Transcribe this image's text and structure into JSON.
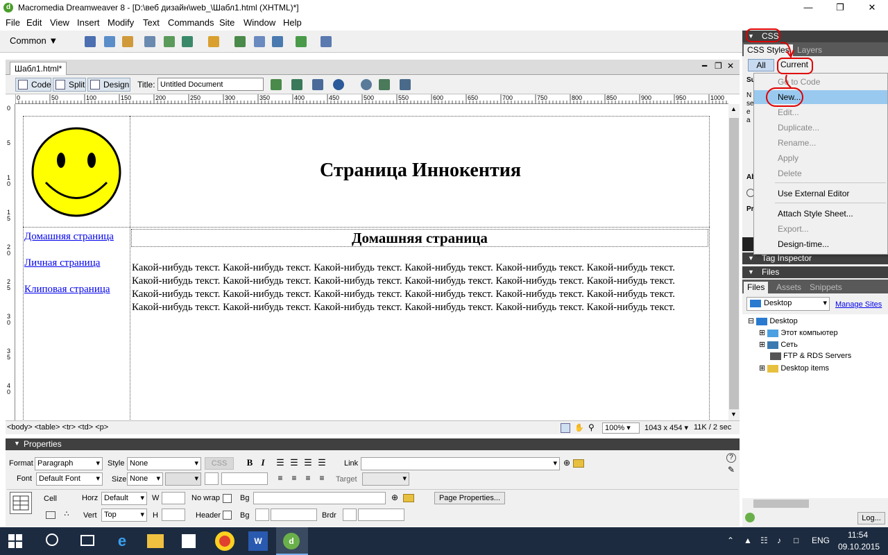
{
  "window": {
    "title": "Macromedia Dreamweaver 8 - [D:\\веб дизайн\\web_\\Шабл1.html (XHTML)*]"
  },
  "menu": [
    "File",
    "Edit",
    "View",
    "Insert",
    "Modify",
    "Text",
    "Commands",
    "Site",
    "Window",
    "Help"
  ],
  "insert_bar": {
    "category": "Common"
  },
  "doc_tab": {
    "label": "Шабл1.html*"
  },
  "doc_toolbar": {
    "code_label": "Code",
    "split_label": "Split",
    "design_label": "Design",
    "title_label": "Title:",
    "title_value": "Untitled Document"
  },
  "ruler": {
    "h_ticks": [
      "0",
      "50",
      "100",
      "150",
      "200",
      "250",
      "300",
      "350",
      "400",
      "450",
      "500",
      "550",
      "600",
      "650",
      "700",
      "750",
      "800",
      "850",
      "900",
      "950",
      "1000"
    ],
    "v_ticks": [
      "0",
      "5",
      "1 0",
      "1 5",
      "2 0",
      "2 5",
      "3 0",
      "3 5",
      "4 0"
    ]
  },
  "page": {
    "heading": "Страница Иннокентия",
    "subheading": "Домашняя страница",
    "nav": [
      "Домашняя страница",
      "Личная страница",
      "Клиповая страница"
    ],
    "body_text": "Какой-нибудь текст. Какой-нибудь текст. Какой-нибудь текст. Какой-нибудь текст. Какой-нибудь текст. Какой-нибудь текст. Какой-нибудь текст. Какой-нибудь текст. Какой-нибудь текст. Какой-нибудь текст. Какой-нибудь текст. Какой-нибудь текст. Какой-нибудь текст. Какой-нибудь текст. Какой-нибудь текст. Какой-нибудь текст. Какой-нибудь текст. Какой-нибудь текст. Какой-нибудь текст. Какой-нибудь текст. Какой-нибудь текст. Какой-нибудь текст. Какой-нибудь текст. Какой-нибудь текст."
  },
  "status": {
    "tags": "<body> <table> <tr> <td> <p>",
    "zoom": "100%",
    "size": "1043 x 454",
    "download": "11K / 2 sec"
  },
  "properties": {
    "header": "Properties",
    "format_label": "Format",
    "format_value": "Paragraph",
    "style_label": "Style",
    "style_value": "None",
    "css_label": "CSS",
    "bold": "B",
    "italic": "I",
    "link_label": "Link",
    "font_label": "Font",
    "font_value": "Default Font",
    "size_label": "Size",
    "size_value": "None",
    "target_label": "Target",
    "cell_label": "Cell",
    "horz_label": "Horz",
    "horz_value": "Default",
    "w_label": "W",
    "nowrap_label": "No wrap",
    "bg_label": "Bg",
    "page_props": "Page Properties...",
    "vert_label": "Vert",
    "vert_value": "Top",
    "h_label": "H",
    "header_label": "Header",
    "brdr_label": "Brdr"
  },
  "css_panel": {
    "header": "CSS",
    "tabs": [
      "CSS Styles",
      "Layers"
    ],
    "modes": [
      "All",
      "Current"
    ],
    "side_letters": {
      "s1": "Su",
      "s2": "N",
      "s3": "se",
      "s4": "e",
      "s5": "a",
      "ab": "Ab",
      "pr": "Pr"
    }
  },
  "context_menu": {
    "items": [
      {
        "label": "Go to Code",
        "disabled": true
      },
      {
        "label": "New...",
        "disabled": false,
        "highlighted": true
      },
      {
        "label": "Edit...",
        "disabled": true
      },
      {
        "label": "Duplicate...",
        "disabled": true
      },
      {
        "label": "Rename...",
        "disabled": true
      },
      {
        "label": "Apply",
        "disabled": true
      },
      {
        "label": "Delete",
        "disabled": true
      },
      {
        "label": "Use External Editor",
        "disabled": false
      },
      {
        "label": "Attach Style Sheet...",
        "disabled": false
      },
      {
        "label": "Export...",
        "disabled": true
      },
      {
        "label": "Design-time...",
        "disabled": false
      }
    ]
  },
  "tag_inspector": {
    "header": "Tag Inspector"
  },
  "files_panel": {
    "header": "Files",
    "tabs": [
      "Files",
      "Assets",
      "Snippets"
    ],
    "site_select": "Desktop",
    "manage_sites": "Manage Sites",
    "tree": [
      "Desktop",
      "Этот компьютер",
      "Сеть",
      "FTP & RDS Servers",
      "Desktop items"
    ],
    "log_button": "Log..."
  },
  "taskbar": {
    "lang": "ENG",
    "time": "11:54",
    "date": "09.10.2015"
  },
  "colors": {
    "accent_red": "#e00000",
    "panel_dark": "#404040",
    "link": "#0000ee",
    "smiley": "#ffff00",
    "taskbar": "#1c2b40"
  }
}
